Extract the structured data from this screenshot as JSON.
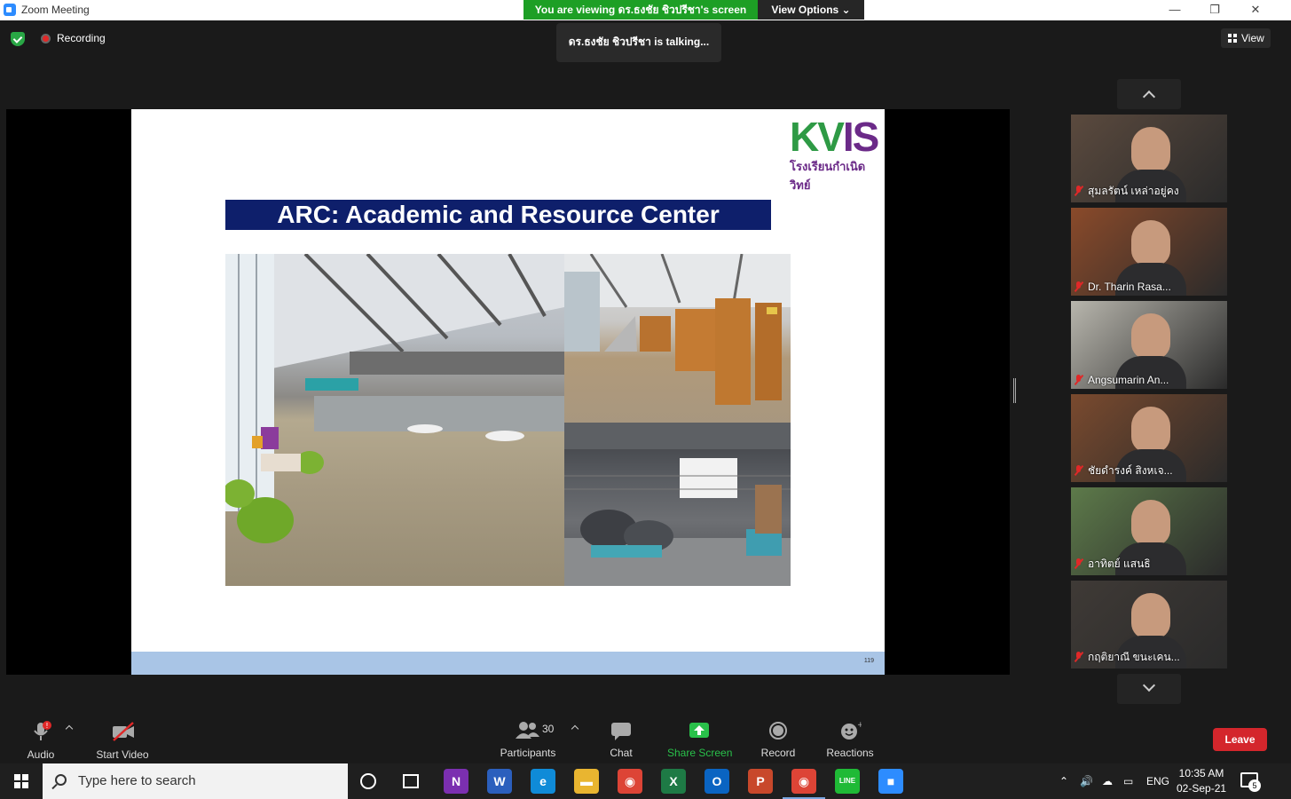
{
  "window": {
    "title": "Zoom Meeting",
    "viewing_banner": "You are viewing ดร.ธงชัย ชิวปรีชา's screen",
    "view_options": "View Options ⌄",
    "minimize": "—",
    "restore": "❐",
    "close": "✕"
  },
  "meeting": {
    "recording_label": "Recording",
    "talking": "ดร.ธงชัย ชิวปรีชา is  talking...",
    "view_label": "View"
  },
  "slide": {
    "logo_main": "KV",
    "logo_accent": "IS",
    "logo_sub": "โรงเรียนกำเนิดวิทย์",
    "title": "ARC: Academic and Resource Center",
    "page_number": "119"
  },
  "participants_panel": {
    "tiles": [
      {
        "name": "สุมลรัตน์ เหล่าอยู่คง",
        "bg": "#5b4a3e"
      },
      {
        "name": "Dr. Tharin Rasa...",
        "bg": "#8a4a2a"
      },
      {
        "name": "Angsumarin An...",
        "bg": "#b8b6ad"
      },
      {
        "name": "ชัยดำรงค์  สิงหเจ...",
        "bg": "#7a4a2e"
      },
      {
        "name": "อาทิตย์ แสนธิ",
        "bg": "#5d7a4a"
      },
      {
        "name": "กฤติยาณี ขนะเคน...",
        "bg": "#3f3a36"
      }
    ]
  },
  "toolbar": {
    "audio": "Audio",
    "start_video": "Start Video",
    "participants_count": "30",
    "participants": "Participants",
    "chat": "Chat",
    "share_screen": "Share Screen",
    "record": "Record",
    "reactions": "Reactions",
    "leave": "Leave"
  },
  "taskbar": {
    "search_placeholder": "Type here to search",
    "language": "ENG",
    "time": "10:35 AM",
    "date": "02-Sep-21",
    "notification_count": "5",
    "apps": [
      {
        "name": "onenote",
        "glyph": "N",
        "color": "#7b2fb0"
      },
      {
        "name": "word",
        "glyph": "W",
        "color": "#2b5fbd"
      },
      {
        "name": "edge",
        "glyph": "e",
        "color": "#0f8bd8"
      },
      {
        "name": "file-explorer",
        "glyph": "▬",
        "color": "#e9b530"
      },
      {
        "name": "chrome",
        "glyph": "◉",
        "color": "#dd4436"
      },
      {
        "name": "excel",
        "glyph": "X",
        "color": "#1e7a45"
      },
      {
        "name": "outlook",
        "glyph": "O",
        "color": "#0a64c2"
      },
      {
        "name": "powerpoint",
        "glyph": "P",
        "color": "#c8482b"
      },
      {
        "name": "chrome-active",
        "glyph": "◉",
        "color": "#dd4436"
      },
      {
        "name": "line",
        "glyph": "LINE",
        "color": "#1fba36"
      },
      {
        "name": "zoom",
        "glyph": "■",
        "color": "#2d8cff"
      }
    ]
  },
  "colors": {
    "accent_green": "#1d9f25",
    "leave_red": "#d4262c",
    "slide_title_bg": "#0e1f6b"
  }
}
